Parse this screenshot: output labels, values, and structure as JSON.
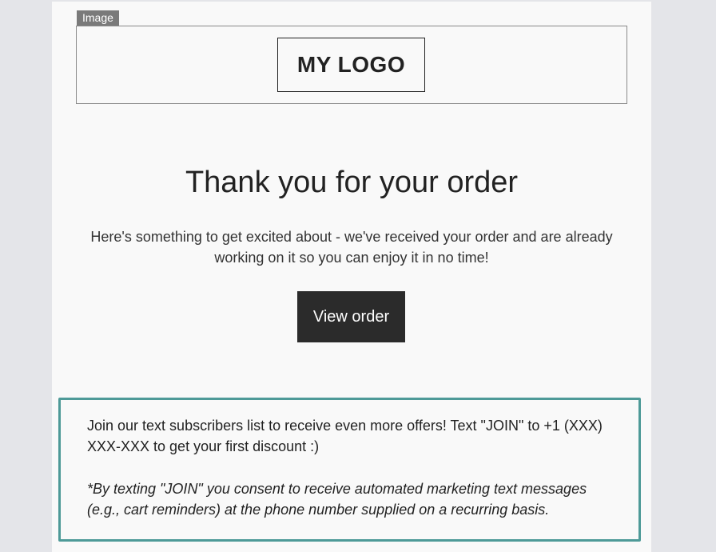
{
  "image_tag": "Image",
  "logo": {
    "text": "MY LOGO"
  },
  "hero": {
    "title": "Thank you for your order",
    "description": "Here's something to get excited about - we've received your order and are already working on it so you can enjoy it in no time!",
    "button_label": "View order"
  },
  "sms": {
    "text": "Join our text subscribers list to receive even more offers! Text \"JOIN\" to +1 (XXX) XXX-XXX to get your first discount :)",
    "disclaimer": "*By texting \"JOIN\" you consent to receive automated marketing text messages (e.g., cart reminders) at the phone number supplied on a recurring basis."
  },
  "colors": {
    "page_bg": "#e4e5e9",
    "canvas_bg": "#f9f9f9",
    "button_bg": "#2b2b2b",
    "sms_border": "#4e9a98",
    "image_tag_bg": "#7a7a7a"
  }
}
